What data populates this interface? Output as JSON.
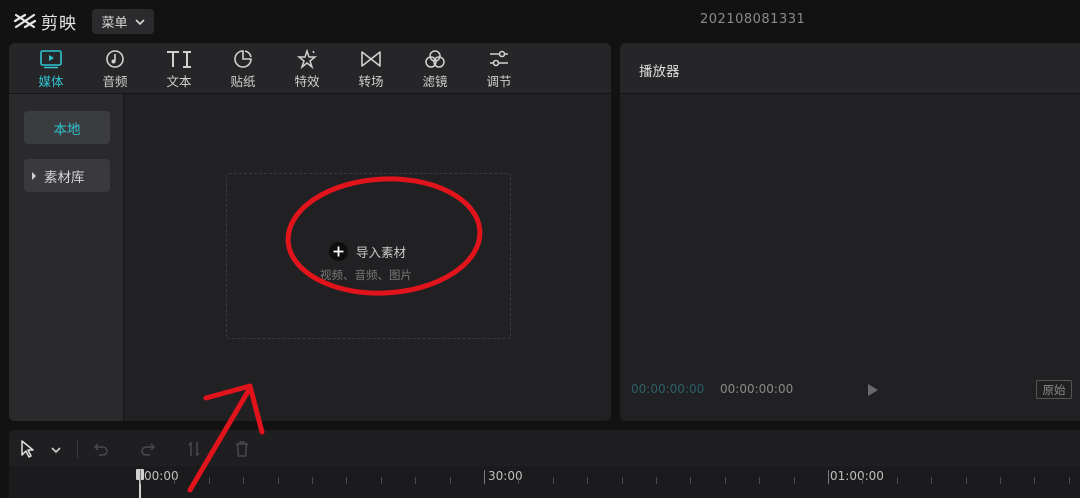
{
  "app": {
    "name": "剪映"
  },
  "menu": {
    "label": "菜单"
  },
  "project": {
    "title": "202108081331"
  },
  "toolbar": {
    "items": [
      {
        "label": "媒体",
        "icon": "media-icon",
        "active": true
      },
      {
        "label": "音频",
        "icon": "audio-icon"
      },
      {
        "label": "文本",
        "icon": "text-icon"
      },
      {
        "label": "贴纸",
        "icon": "sticker-icon"
      },
      {
        "label": "特效",
        "icon": "effects-icon"
      },
      {
        "label": "转场",
        "icon": "transition-icon"
      },
      {
        "label": "滤镜",
        "icon": "filter-icon"
      },
      {
        "label": "调节",
        "icon": "adjust-icon"
      }
    ]
  },
  "sidebar": {
    "local": "本地",
    "library": "素材库"
  },
  "import": {
    "label": "导入素材",
    "subtitle": "视频、音频、图片"
  },
  "player": {
    "title": "播放器",
    "current_time": "00:00:00:00",
    "total_time": "00:00:00:00",
    "ratio_label": "原始"
  },
  "timeline": {
    "labels": [
      "00:00",
      "30:00",
      "01:00:00"
    ]
  },
  "colors": {
    "accent": "#2fc3cf",
    "background": "#121212",
    "panel": "#212124",
    "annotation": "#e0141a"
  }
}
